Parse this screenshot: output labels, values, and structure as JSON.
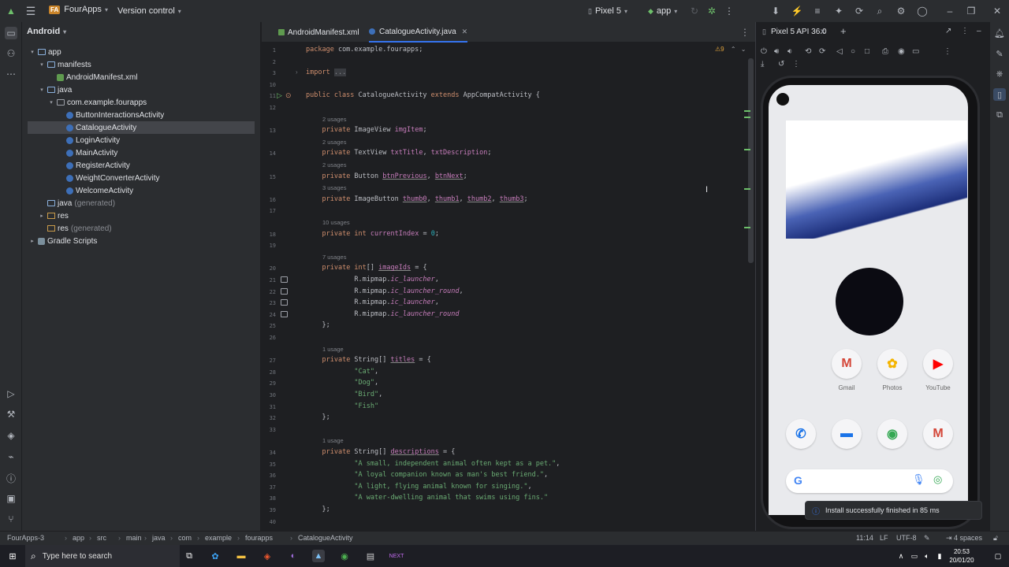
{
  "titlebar": {
    "project_badge": "FA",
    "project_name": "FourApps",
    "vcs": "Version control",
    "device": "Pixel 5",
    "run_config": "app"
  },
  "project_panel": {
    "view_mode": "Android",
    "tree": [
      {
        "label": "app",
        "suffix": "",
        "depth": 0,
        "icon": "folder-icon",
        "arrow": "▾"
      },
      {
        "label": "manifests",
        "suffix": "",
        "depth": 1,
        "icon": "folder-icon",
        "arrow": "▾"
      },
      {
        "label": "AndroidManifest.xml",
        "suffix": "",
        "depth": 2,
        "icon": "xml-file-icon",
        "arrow": ""
      },
      {
        "label": "java",
        "suffix": "",
        "depth": 1,
        "icon": "folder-icon",
        "arrow": "▾"
      },
      {
        "label": "com.example.fourapps",
        "suffix": "",
        "depth": 2,
        "icon": "package-icon",
        "arrow": "▾"
      },
      {
        "label": "ButtonInteractionsActivity",
        "suffix": "",
        "depth": 3,
        "icon": "class-icon",
        "arrow": ""
      },
      {
        "label": "CatalogueActivity",
        "suffix": "",
        "depth": 3,
        "icon": "class-icon",
        "arrow": "",
        "selected": true
      },
      {
        "label": "LoginActivity",
        "suffix": "",
        "depth": 3,
        "icon": "class-icon",
        "arrow": ""
      },
      {
        "label": "MainActivity",
        "suffix": "",
        "depth": 3,
        "icon": "class-icon",
        "arrow": ""
      },
      {
        "label": "RegisterActivity",
        "suffix": "",
        "depth": 3,
        "icon": "class-icon",
        "arrow": ""
      },
      {
        "label": "WeightConverterActivity",
        "suffix": "",
        "depth": 3,
        "icon": "class-icon",
        "arrow": ""
      },
      {
        "label": "WelcomeActivity",
        "suffix": "",
        "depth": 3,
        "icon": "class-icon",
        "arrow": ""
      },
      {
        "label": "java",
        "suffix": "(generated)",
        "depth": 1,
        "icon": "folder-icon",
        "arrow": ""
      },
      {
        "label": "res",
        "suffix": "",
        "depth": 1,
        "icon": "res-folder-icon",
        "arrow": "▸"
      },
      {
        "label": "res",
        "suffix": "(generated)",
        "depth": 1,
        "icon": "res-folder-icon",
        "arrow": ""
      },
      {
        "label": "Gradle Scripts",
        "suffix": "",
        "depth": 0,
        "icon": "gradle-icon",
        "arrow": "▸"
      }
    ]
  },
  "editor": {
    "tabs": [
      {
        "label": "AndroidManifest.xml",
        "active": false
      },
      {
        "label": "CatalogueActivity.java",
        "active": true
      }
    ],
    "warnings": "9",
    "lines": [
      {
        "n": "1",
        "usage": "",
        "html": "<span class=\"kw\">package</span> com.example.fourapps;"
      },
      {
        "n": "2",
        "usage": "",
        "html": ""
      },
      {
        "n": "3",
        "usage": "",
        "html": "<span class=\"kw\">import</span> <span style=\"background:#393b40;color:#8a8d93\">...</span>"
      },
      {
        "n": "10",
        "usage": "",
        "html": ""
      },
      {
        "n": "11",
        "usage": "",
        "html": "<span class=\"kw\">public class</span> CatalogueActivity <span class=\"kw\">extends</span> AppCompatActivity {"
      },
      {
        "n": "12",
        "usage": "",
        "html": ""
      },
      {
        "n": "13",
        "usage": "2 usages",
        "html": "    <span class=\"kw\">private</span> ImageView <span class=\"fld\">imgItem</span>;"
      },
      {
        "n": "14",
        "usage": "2 usages",
        "html": "    <span class=\"kw\">private</span> TextView <span class=\"fld\">txtTitle</span>, <span class=\"fld\">txtDescription</span>;"
      },
      {
        "n": "15",
        "usage": "2 usages",
        "html": "    <span class=\"kw\">private</span> Button <span class=\"fld ul\">btnPrevious</span>, <span class=\"fld ul\">btnNext</span>;"
      },
      {
        "n": "16",
        "usage": "3 usages",
        "html": "    <span class=\"kw\">private</span> ImageButton <span class=\"fld ul\">thumb0</span>, <span class=\"fld ul\">thumb1</span>, <span class=\"fld ul\">thumb2</span>, <span class=\"fld ul\">thumb3</span>;"
      },
      {
        "n": "17",
        "usage": "",
        "html": ""
      },
      {
        "n": "18",
        "usage": "10 usages",
        "html": "    <span class=\"kw\">private int</span> <span class=\"fld\">currentIndex</span> = <span style=\"color:#2aacb8\">0</span>;"
      },
      {
        "n": "19",
        "usage": "",
        "html": ""
      },
      {
        "n": "20",
        "usage": "7 usages",
        "html": "    <span class=\"kw\">private int</span>[] <span class=\"fld ul\">imageIds</span> = {"
      },
      {
        "n": "21",
        "usage": "",
        "html": "            R.mipmap.<span class=\"it\">ic_launcher</span>,"
      },
      {
        "n": "22",
        "usage": "",
        "html": "            R.mipmap.<span class=\"it\">ic_launcher_round</span>,"
      },
      {
        "n": "23",
        "usage": "",
        "html": "            R.mipmap.<span class=\"it\">ic_launcher</span>,"
      },
      {
        "n": "24",
        "usage": "",
        "html": "            R.mipmap.<span class=\"it\">ic_launcher_round</span>"
      },
      {
        "n": "25",
        "usage": "",
        "html": "    };"
      },
      {
        "n": "26",
        "usage": "",
        "html": ""
      },
      {
        "n": "27",
        "usage": "1 usage",
        "html": "    <span class=\"kw\">private</span> String[] <span class=\"fld ul\">titles</span> = {"
      },
      {
        "n": "28",
        "usage": "",
        "html": "            <span class=\"str\">\"Cat\"</span>,"
      },
      {
        "n": "29",
        "usage": "",
        "html": "            <span class=\"str\">\"Dog\"</span>,"
      },
      {
        "n": "30",
        "usage": "",
        "html": "            <span class=\"str\">\"Bird\"</span>,"
      },
      {
        "n": "31",
        "usage": "",
        "html": "            <span class=\"str\">\"Fish\"</span>"
      },
      {
        "n": "32",
        "usage": "",
        "html": "    };"
      },
      {
        "n": "33",
        "usage": "",
        "html": ""
      },
      {
        "n": "34",
        "usage": "1 usage",
        "html": "    <span class=\"kw\">private</span> String[] <span class=\"fld ul\">descriptions</span> = {"
      },
      {
        "n": "35",
        "usage": "",
        "html": "            <span class=\"str\">\"A small, independent animal often kept as a pet.\"</span>,"
      },
      {
        "n": "36",
        "usage": "",
        "html": "            <span class=\"str\">\"A loyal companion known as man's best friend.\"</span>,"
      },
      {
        "n": "37",
        "usage": "",
        "html": "            <span class=\"str\">\"A light, flying animal known for singing.\"</span>,"
      },
      {
        "n": "38",
        "usage": "",
        "html": "            <span class=\"str\">\"A water-dwelling animal that swims using fins.\"</span>"
      },
      {
        "n": "39",
        "usage": "",
        "html": "    };"
      },
      {
        "n": "40",
        "usage": "",
        "html": ""
      }
    ]
  },
  "emulator": {
    "device_tab": "Pixel 5 API 36.0",
    "apps_row1": [
      {
        "label": "Gmail",
        "glyph": "M",
        "color": "#d44638"
      },
      {
        "label": "Photos",
        "glyph": "✿",
        "color": "#f4b400"
      },
      {
        "label": "YouTube",
        "glyph": "▶",
        "color": "#ff0000"
      }
    ],
    "dock": [
      {
        "glyph": "✆",
        "color": "#1a73e8"
      },
      {
        "glyph": "▬",
        "color": "#1a73e8"
      },
      {
        "glyph": "◉",
        "color": "#34a853"
      },
      {
        "glyph": "M",
        "color": "#d44638"
      }
    ],
    "search_glyph": "G",
    "notification": "Install successfully finished in 85 ms"
  },
  "statusbar": {
    "crumbs": [
      "FourApps-3",
      "app",
      "src",
      "main",
      "java",
      "com",
      "example",
      "fourapps",
      "CatalogueActivity"
    ],
    "position": "11:14",
    "line_sep": "LF",
    "encoding": "UTF-8",
    "indent": "4 spaces"
  },
  "taskbar": {
    "search_placeholder": "Type here to search",
    "time": "20:53",
    "date": "20/01/20"
  }
}
